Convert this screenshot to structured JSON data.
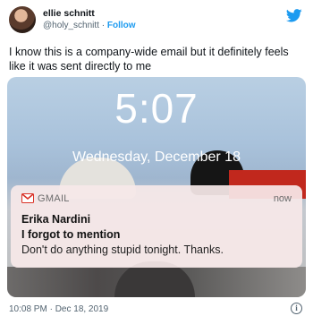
{
  "tweet": {
    "author_name": "ellie schnitt",
    "author_handle": "@holy_schnitt",
    "separator": "·",
    "follow_label": "Follow",
    "text": "I know this is a company-wide email but it definitely feels like it was sent directly to me",
    "timestamp": "10:08 PM · Dec 18, 2019",
    "info_symbol": "i"
  },
  "lockscreen": {
    "time": "5:07",
    "date": "Wednesday, December 18"
  },
  "notification": {
    "app_name": "GMAIL",
    "time": "now",
    "sender": "Erika Nardini",
    "subject": "I forgot to mention",
    "snippet": "Don't do anything stupid tonight. Thanks."
  },
  "colors": {
    "twitter_blue": "#1d9bf0",
    "gmail_red": "#d93025"
  },
  "icons": [
    "avatar",
    "twitter-bird-icon",
    "gmail-icon",
    "info-icon"
  ]
}
